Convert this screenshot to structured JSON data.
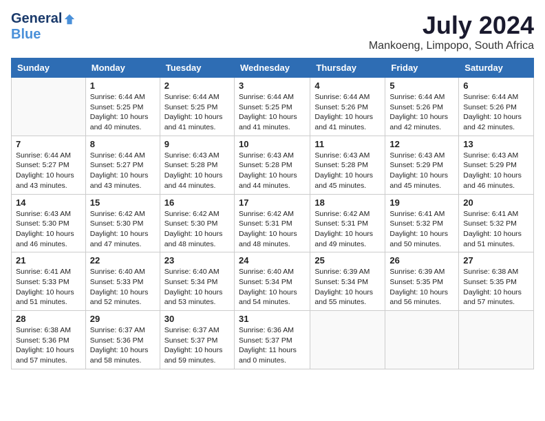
{
  "logo": {
    "general": "General",
    "blue": "Blue"
  },
  "title": {
    "month_year": "July 2024",
    "location": "Mankoeng, Limpopo, South Africa"
  },
  "headers": [
    "Sunday",
    "Monday",
    "Tuesday",
    "Wednesday",
    "Thursday",
    "Friday",
    "Saturday"
  ],
  "weeks": [
    [
      {
        "day": "",
        "info": ""
      },
      {
        "day": "1",
        "info": "Sunrise: 6:44 AM\nSunset: 5:25 PM\nDaylight: 10 hours\nand 40 minutes."
      },
      {
        "day": "2",
        "info": "Sunrise: 6:44 AM\nSunset: 5:25 PM\nDaylight: 10 hours\nand 41 minutes."
      },
      {
        "day": "3",
        "info": "Sunrise: 6:44 AM\nSunset: 5:25 PM\nDaylight: 10 hours\nand 41 minutes."
      },
      {
        "day": "4",
        "info": "Sunrise: 6:44 AM\nSunset: 5:26 PM\nDaylight: 10 hours\nand 41 minutes."
      },
      {
        "day": "5",
        "info": "Sunrise: 6:44 AM\nSunset: 5:26 PM\nDaylight: 10 hours\nand 42 minutes."
      },
      {
        "day": "6",
        "info": "Sunrise: 6:44 AM\nSunset: 5:26 PM\nDaylight: 10 hours\nand 42 minutes."
      }
    ],
    [
      {
        "day": "7",
        "info": "Sunrise: 6:44 AM\nSunset: 5:27 PM\nDaylight: 10 hours\nand 43 minutes."
      },
      {
        "day": "8",
        "info": "Sunrise: 6:44 AM\nSunset: 5:27 PM\nDaylight: 10 hours\nand 43 minutes."
      },
      {
        "day": "9",
        "info": "Sunrise: 6:43 AM\nSunset: 5:28 PM\nDaylight: 10 hours\nand 44 minutes."
      },
      {
        "day": "10",
        "info": "Sunrise: 6:43 AM\nSunset: 5:28 PM\nDaylight: 10 hours\nand 44 minutes."
      },
      {
        "day": "11",
        "info": "Sunrise: 6:43 AM\nSunset: 5:28 PM\nDaylight: 10 hours\nand 45 minutes."
      },
      {
        "day": "12",
        "info": "Sunrise: 6:43 AM\nSunset: 5:29 PM\nDaylight: 10 hours\nand 45 minutes."
      },
      {
        "day": "13",
        "info": "Sunrise: 6:43 AM\nSunset: 5:29 PM\nDaylight: 10 hours\nand 46 minutes."
      }
    ],
    [
      {
        "day": "14",
        "info": "Sunrise: 6:43 AM\nSunset: 5:30 PM\nDaylight: 10 hours\nand 46 minutes."
      },
      {
        "day": "15",
        "info": "Sunrise: 6:42 AM\nSunset: 5:30 PM\nDaylight: 10 hours\nand 47 minutes."
      },
      {
        "day": "16",
        "info": "Sunrise: 6:42 AM\nSunset: 5:30 PM\nDaylight: 10 hours\nand 48 minutes."
      },
      {
        "day": "17",
        "info": "Sunrise: 6:42 AM\nSunset: 5:31 PM\nDaylight: 10 hours\nand 48 minutes."
      },
      {
        "day": "18",
        "info": "Sunrise: 6:42 AM\nSunset: 5:31 PM\nDaylight: 10 hours\nand 49 minutes."
      },
      {
        "day": "19",
        "info": "Sunrise: 6:41 AM\nSunset: 5:32 PM\nDaylight: 10 hours\nand 50 minutes."
      },
      {
        "day": "20",
        "info": "Sunrise: 6:41 AM\nSunset: 5:32 PM\nDaylight: 10 hours\nand 51 minutes."
      }
    ],
    [
      {
        "day": "21",
        "info": "Sunrise: 6:41 AM\nSunset: 5:33 PM\nDaylight: 10 hours\nand 51 minutes."
      },
      {
        "day": "22",
        "info": "Sunrise: 6:40 AM\nSunset: 5:33 PM\nDaylight: 10 hours\nand 52 minutes."
      },
      {
        "day": "23",
        "info": "Sunrise: 6:40 AM\nSunset: 5:34 PM\nDaylight: 10 hours\nand 53 minutes."
      },
      {
        "day": "24",
        "info": "Sunrise: 6:40 AM\nSunset: 5:34 PM\nDaylight: 10 hours\nand 54 minutes."
      },
      {
        "day": "25",
        "info": "Sunrise: 6:39 AM\nSunset: 5:34 PM\nDaylight: 10 hours\nand 55 minutes."
      },
      {
        "day": "26",
        "info": "Sunrise: 6:39 AM\nSunset: 5:35 PM\nDaylight: 10 hours\nand 56 minutes."
      },
      {
        "day": "27",
        "info": "Sunrise: 6:38 AM\nSunset: 5:35 PM\nDaylight: 10 hours\nand 57 minutes."
      }
    ],
    [
      {
        "day": "28",
        "info": "Sunrise: 6:38 AM\nSunset: 5:36 PM\nDaylight: 10 hours\nand 57 minutes."
      },
      {
        "day": "29",
        "info": "Sunrise: 6:37 AM\nSunset: 5:36 PM\nDaylight: 10 hours\nand 58 minutes."
      },
      {
        "day": "30",
        "info": "Sunrise: 6:37 AM\nSunset: 5:37 PM\nDaylight: 10 hours\nand 59 minutes."
      },
      {
        "day": "31",
        "info": "Sunrise: 6:36 AM\nSunset: 5:37 PM\nDaylight: 11 hours\nand 0 minutes."
      },
      {
        "day": "",
        "info": ""
      },
      {
        "day": "",
        "info": ""
      },
      {
        "day": "",
        "info": ""
      }
    ]
  ]
}
